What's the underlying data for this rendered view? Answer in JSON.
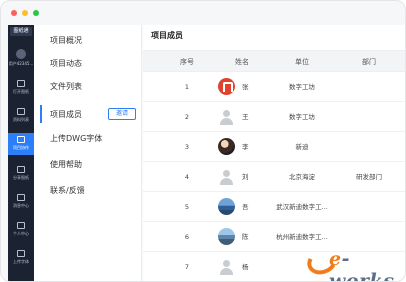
{
  "window": {
    "dots": [
      "#ff5f57",
      "#febc2e",
      "#28c840"
    ]
  },
  "appbar": {
    "logo": "图纸通",
    "user": "用户42345...",
    "items": [
      {
        "label": "打开图纸",
        "active": false
      },
      {
        "label": "资料列表",
        "active": false
      },
      {
        "label": "项目协作",
        "active": true
      },
      {
        "label": "分享图纸",
        "active": false
      },
      {
        "label": "消息中心",
        "active": false
      },
      {
        "label": "个人中心",
        "active": false
      },
      {
        "label": "上传字体",
        "active": false
      }
    ]
  },
  "subnav": {
    "items": [
      {
        "label": "项目概况",
        "active": false
      },
      {
        "label": "项目动态",
        "active": false
      },
      {
        "label": "文件列表",
        "active": false
      },
      {
        "label": "项目成员",
        "active": true
      },
      {
        "label": "上传DWG字体",
        "active": false
      },
      {
        "label": "使用帮助",
        "active": false
      },
      {
        "label": "联系/反馈",
        "active": false
      }
    ],
    "edit_button": "邀请"
  },
  "main": {
    "title": "项目成员",
    "columns": {
      "index": "序号",
      "name": "姓名",
      "unit": "单位",
      "dept": "部门"
    },
    "rows": [
      {
        "index": "1",
        "name": "张",
        "unit": "数字工坊",
        "dept": "",
        "avatar": "logo"
      },
      {
        "index": "2",
        "name": "王",
        "unit": "数字工坊",
        "dept": "",
        "avatar": "person"
      },
      {
        "index": "3",
        "name": "李",
        "unit": "新迪",
        "dept": "",
        "avatar": "photo1"
      },
      {
        "index": "4",
        "name": "刘",
        "unit": "北京海淀",
        "dept": "研发部门",
        "avatar": "person"
      },
      {
        "index": "5",
        "name": "吾",
        "unit": "武汉新迪数字工...",
        "dept": "",
        "avatar": "photo2"
      },
      {
        "index": "6",
        "name": "陈",
        "unit": "杭州新迪数字工...",
        "dept": "",
        "avatar": "photo3"
      },
      {
        "index": "7",
        "name": "杨",
        "unit": "",
        "dept": "",
        "avatar": "person"
      }
    ]
  },
  "watermark": {
    "prefix": "e",
    "text": "-works"
  },
  "colors": {
    "accent": "#2d7ff9",
    "appbar": "#1b2232",
    "watermark_orange": "#f07c1a"
  }
}
